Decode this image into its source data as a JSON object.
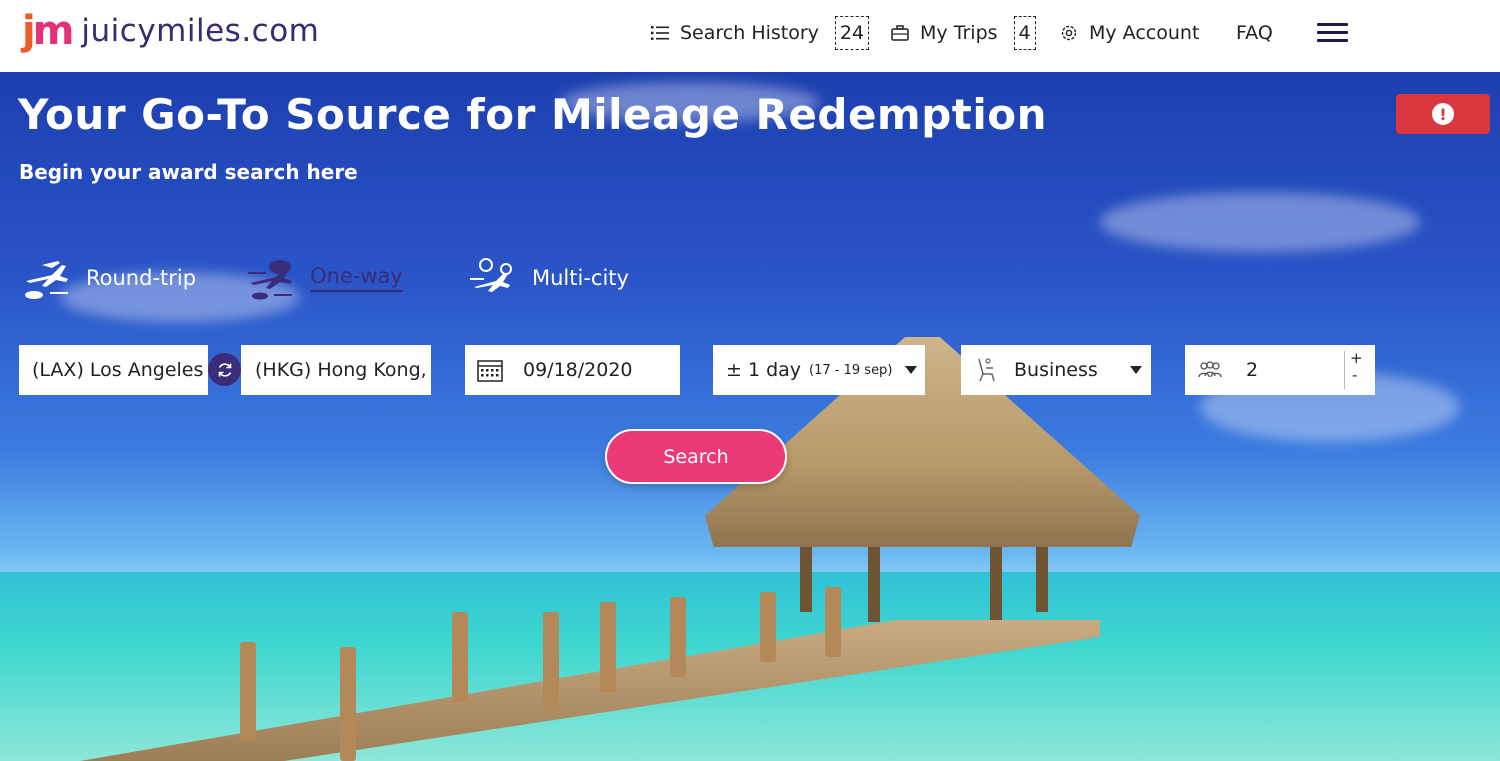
{
  "brand": {
    "logo_mark_j": "j",
    "logo_mark_m": "m",
    "name": "juicymiles.com"
  },
  "nav": {
    "search_history_label": "Search History",
    "search_history_count": "24",
    "my_trips_label": "My Trips",
    "my_trips_count": "4",
    "my_account_label": "My Account",
    "faq_label": "FAQ"
  },
  "hero": {
    "title": "Your Go-To Source for Mileage Redemption",
    "subtitle": "Begin your award search here"
  },
  "trip_types": [
    {
      "label": "Round-trip",
      "active": false
    },
    {
      "label": "One-way",
      "active": true
    },
    {
      "label": "Multi-city",
      "active": false
    }
  ],
  "search": {
    "origin": "(LAX) Los Angeles",
    "destination": "(HKG) Hong Kong,",
    "date": "09/18/2020",
    "flex_label": "± 1 day",
    "flex_range": "(17 - 19 sep)",
    "cabin": "Business",
    "passengers": "2",
    "stepper_plus": "+",
    "stepper_minus": "-",
    "search_label": "Search"
  },
  "alert": {
    "glyph": "!"
  },
  "colors": {
    "brand_purple": "#3b2c7a",
    "search_pink": "#ec3a78",
    "alert_red": "#d9363e"
  }
}
